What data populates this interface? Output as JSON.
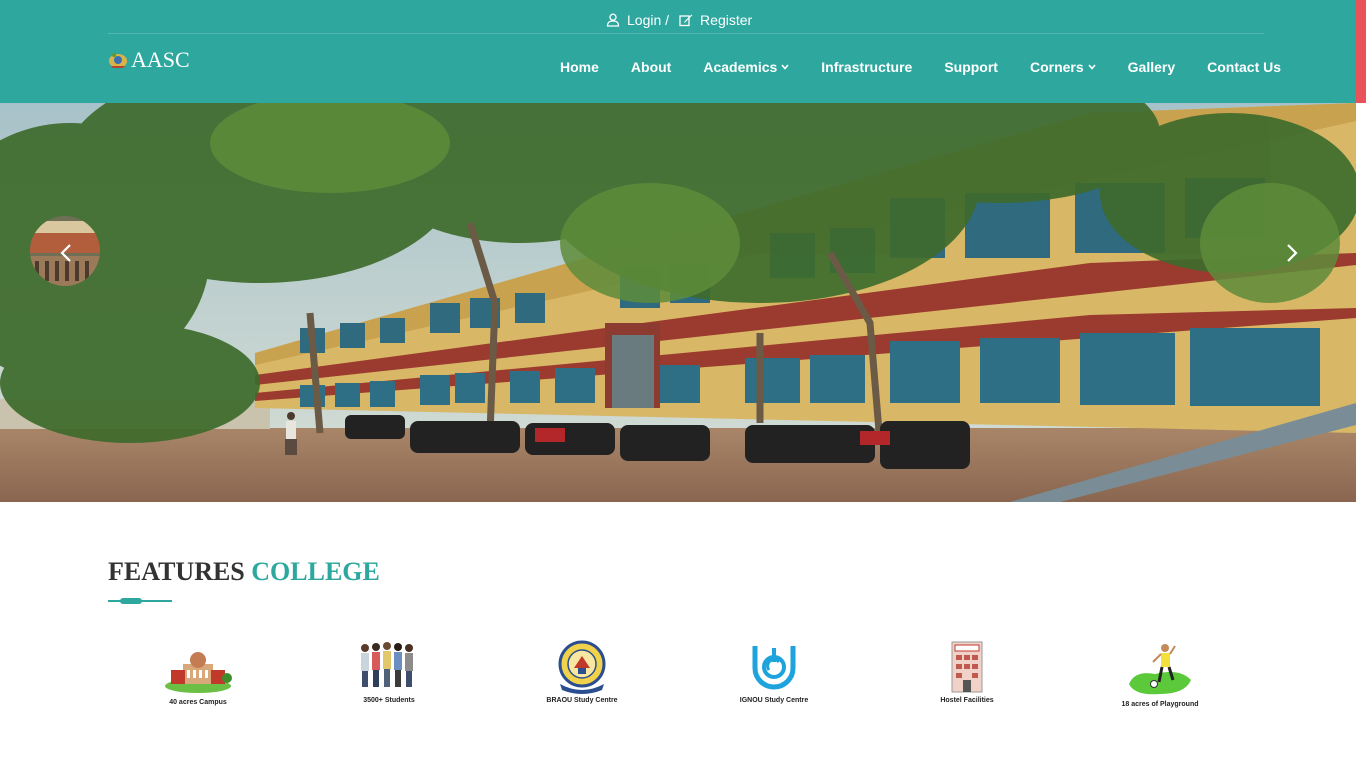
{
  "header": {
    "login_label": "Login /",
    "register_label": "Register",
    "logo_text": "AASC",
    "nav": [
      {
        "label": "Home",
        "has_dropdown": false
      },
      {
        "label": "About",
        "has_dropdown": false
      },
      {
        "label": "Academics",
        "has_dropdown": true
      },
      {
        "label": "Infrastructure",
        "has_dropdown": false
      },
      {
        "label": "Support",
        "has_dropdown": false
      },
      {
        "label": "Corners",
        "has_dropdown": true
      },
      {
        "label": "Gallery",
        "has_dropdown": false
      },
      {
        "label": "Contact Us",
        "has_dropdown": false
      }
    ]
  },
  "hero": {
    "prev_icon": "chevron-left-icon",
    "next_icon": "chevron-right-icon"
  },
  "features": {
    "title_main": "FEATURES",
    "title_accent": "COLLEGE",
    "items": [
      {
        "label": "40 acres Campus",
        "icon": "campus-icon"
      },
      {
        "label": "3500+ Students",
        "icon": "students-icon"
      },
      {
        "label": "BRAOU Study Centre",
        "icon": "braou-emblem-icon"
      },
      {
        "label": "IGNOU Study Centre",
        "icon": "ignou-logo-icon"
      },
      {
        "label": "Hostel Facilities",
        "icon": "hostel-icon"
      },
      {
        "label": "18 acres of Playground",
        "icon": "playground-icon"
      }
    ]
  },
  "colors": {
    "primary": "#2ea89f",
    "accent": "#e8525b",
    "heading": "#333333"
  }
}
